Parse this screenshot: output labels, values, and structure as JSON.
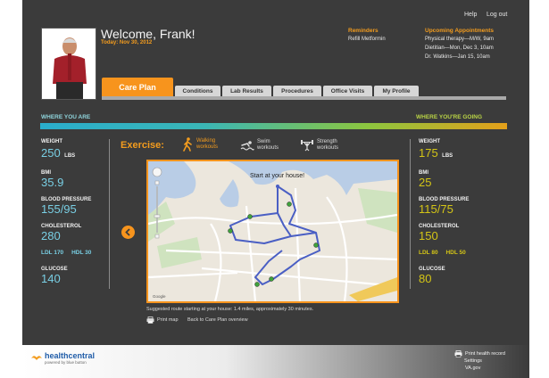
{
  "top_links": {
    "help": "Help",
    "logout": "Log out"
  },
  "header": {
    "welcome": "Welcome, Frank!",
    "date": "Today: Nov 30, 2012",
    "reminders_title": "Reminders",
    "reminders": [
      "Refill Metformin"
    ],
    "appointments_title": "Upcoming Appointments",
    "appointments": [
      "Physical therapy—M/W, 9am",
      "Dietitian—Mon, Dec 3, 10am",
      "Dr. Watkins—Jan 15, 10am"
    ]
  },
  "tabs": {
    "active": "Care Plan",
    "items": [
      "Conditions",
      "Lab Results",
      "Procedures",
      "Office Visits",
      "My Profile"
    ]
  },
  "sections": {
    "left": "WHERE YOU ARE",
    "right": "WHERE YOU'RE GOING"
  },
  "current": {
    "weight_label": "WEIGHT",
    "weight_value": "250",
    "weight_unit": "LBS",
    "bmi_label": "BMI",
    "bmi_value": "35.9",
    "bp_label": "BLOOD PRESSURE",
    "bp_value": "155/95",
    "chol_label": "CHOLESTEROL",
    "chol_value": "280",
    "ldl": "LDL 170",
    "hdl": "HDL 30",
    "glucose_label": "GLUCOSE",
    "glucose_value": "140"
  },
  "goal": {
    "weight_label": "WEIGHT",
    "weight_value": "175",
    "weight_unit": "LBS",
    "bmi_label": "BMI",
    "bmi_value": "25",
    "bp_label": "BLOOD PRESSURE",
    "bp_value": "115/75",
    "chol_label": "CHOLESTEROL",
    "chol_value": "150",
    "ldl": "LDL 80",
    "hdl": "HDL 50",
    "glucose_label": "GLUCOSE",
    "glucose_value": "80"
  },
  "exercise": {
    "title": "Exercise:",
    "options": [
      {
        "line1": "Walking",
        "line2": "workouts"
      },
      {
        "line1": "Swim",
        "line2": "workouts"
      },
      {
        "line1": "Strength",
        "line2": "workouts"
      }
    ]
  },
  "map": {
    "start_label": "Start at your house!"
  },
  "caption": "Suggested route starting at your house: 1.4 miles, approximately 30 minutes.",
  "links": {
    "print_map": "Print map",
    "back": "Back to Care Plan overview"
  },
  "footer": {
    "logo": "healthcentral",
    "logo_sub": "powered by blue button",
    "print_record": "Print health record",
    "settings": "Settings",
    "vagov": "VA.gov"
  },
  "colors": {
    "accent": "#f7941d",
    "current": "#79cfe4",
    "goal": "#d4c516",
    "background": "#3b3b3b"
  }
}
